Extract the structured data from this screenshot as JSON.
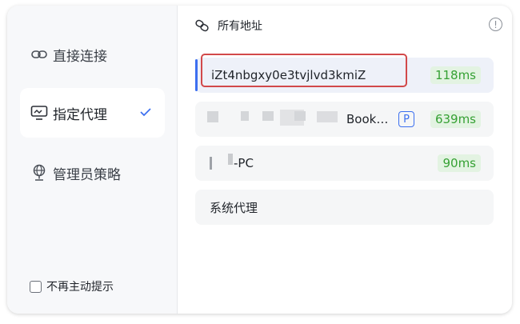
{
  "sidebar": {
    "items": [
      {
        "label": "直接连接",
        "icon": "link-icon",
        "active": false
      },
      {
        "label": "指定代理",
        "icon": "proxy-monitor-icon",
        "active": true
      },
      {
        "label": "管理员策略",
        "icon": "admin-globe-icon",
        "active": false
      }
    ],
    "bottom_option": {
      "label": "不再主动提示",
      "checked": false
    }
  },
  "main": {
    "title": "所有地址",
    "rows": [
      {
        "name": "iZt4nbgxy0e3tvjlvd3kmiZ",
        "latency": "118ms",
        "selected": true
      },
      {
        "name": "Book…",
        "badge": "P",
        "latency": "639ms",
        "selected": false
      },
      {
        "name": "-PC",
        "latency": "90ms",
        "selected": false
      },
      {
        "name": "系统代理",
        "selected": false
      }
    ]
  },
  "colors": {
    "accent": "#3c6ff0",
    "latency_text": "#36a134",
    "latency_bg": "#e3f3e2",
    "annotation": "#d2494a"
  }
}
